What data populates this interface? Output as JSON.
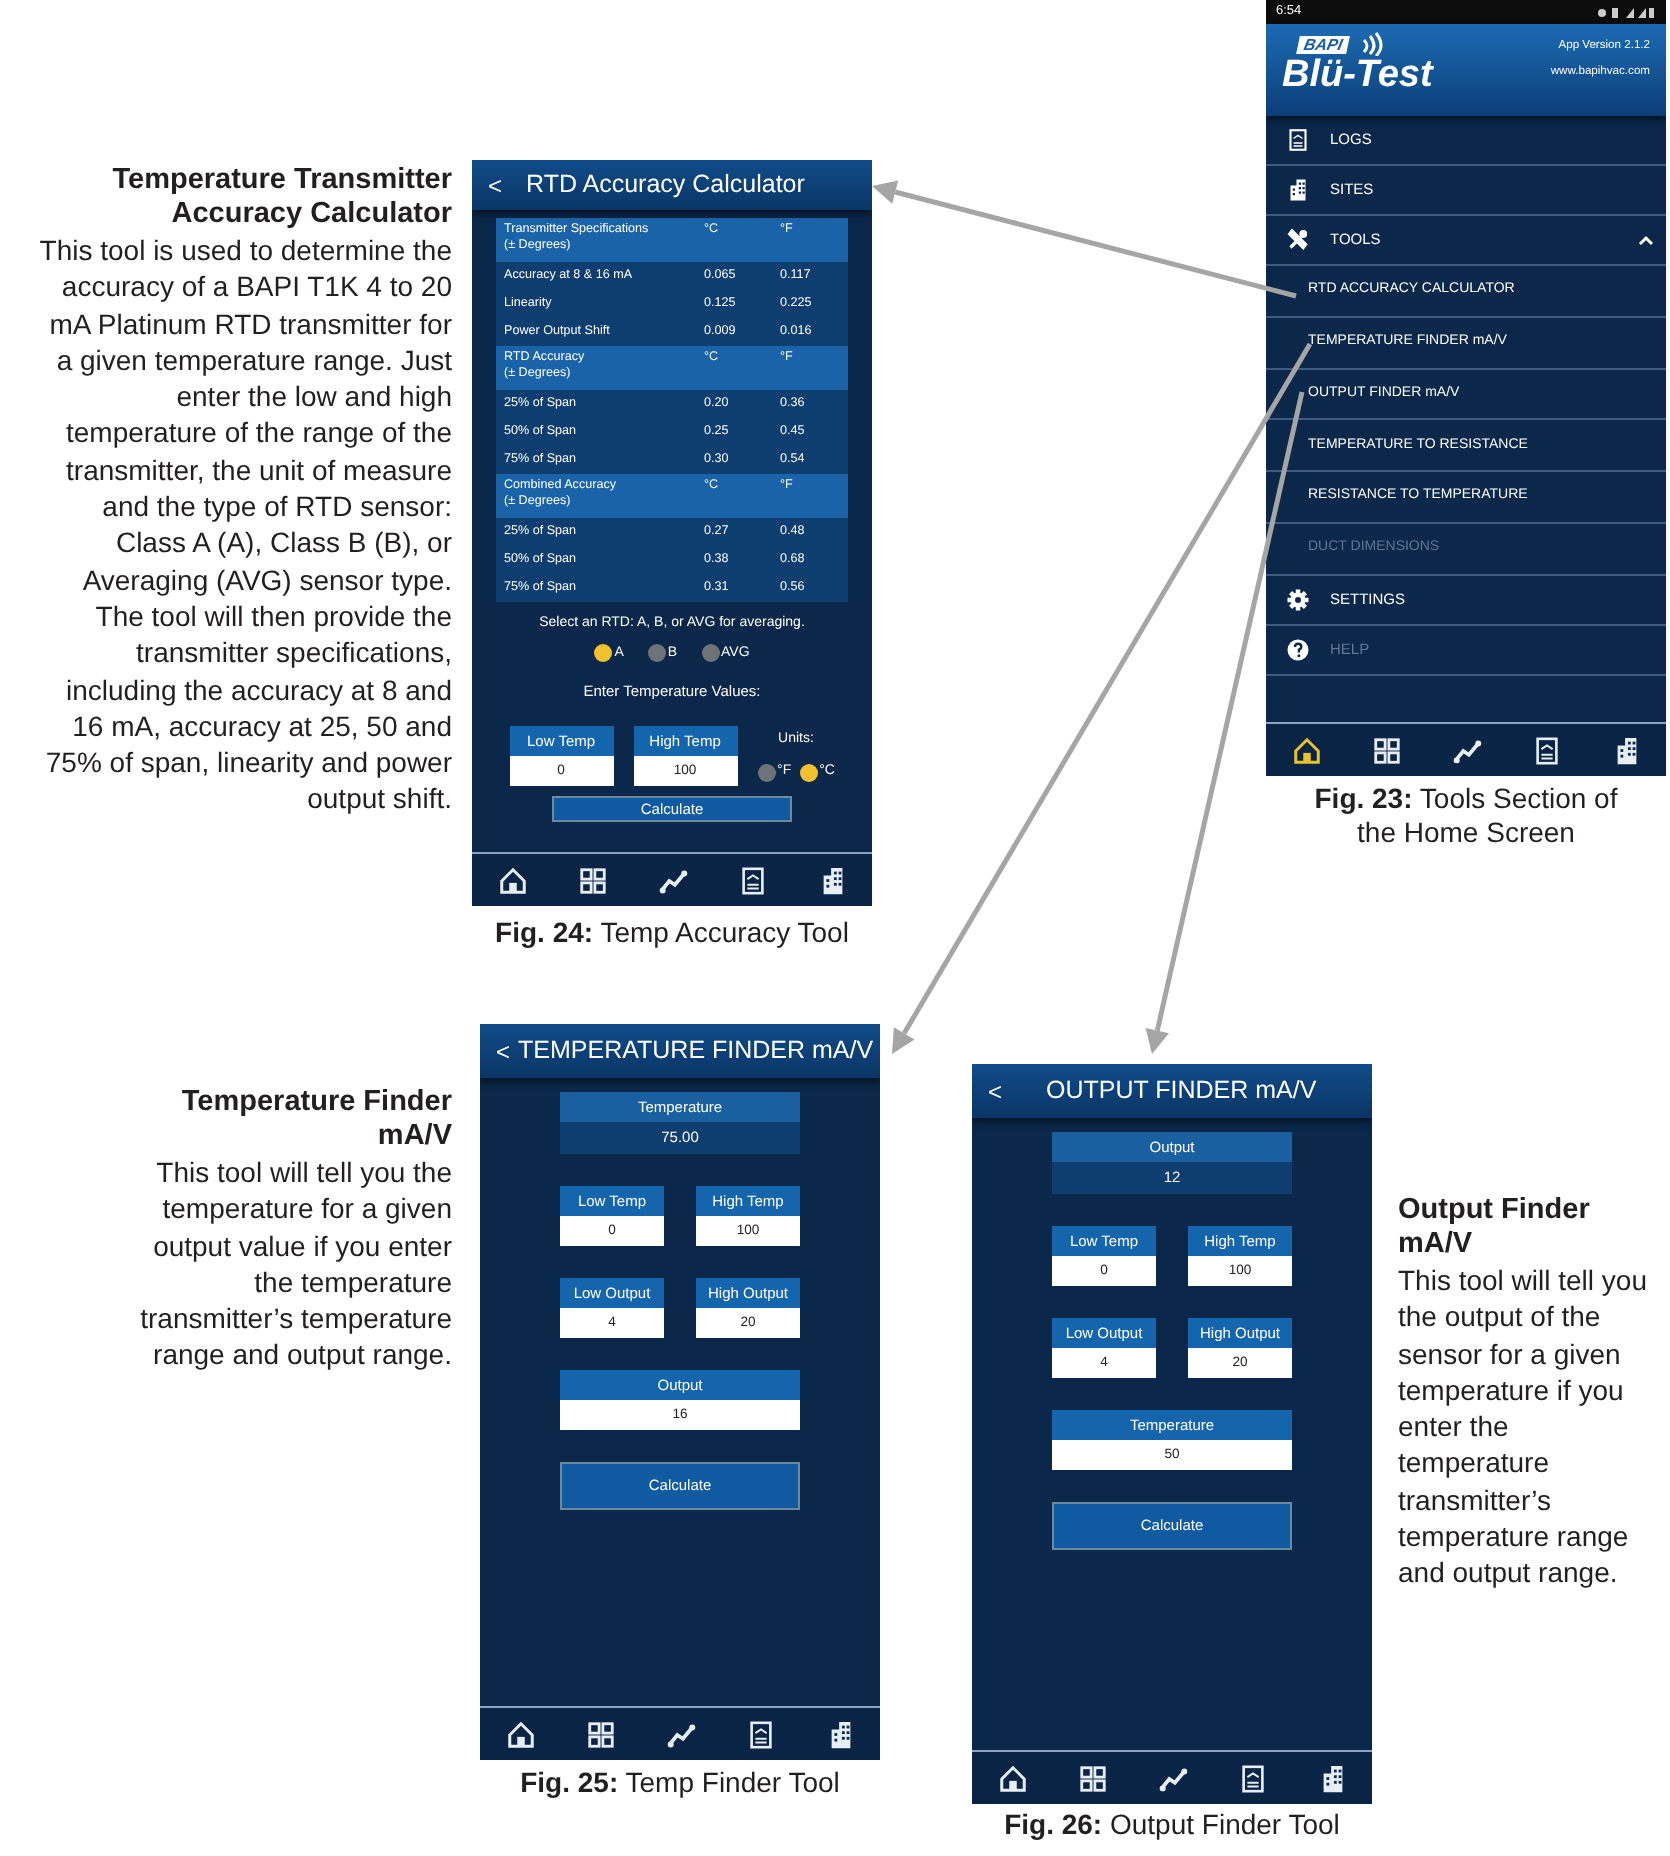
{
  "calculator_section": {
    "heading": "Temperature Transmitter Accuracy Calculator",
    "description": "This tool is used to determine the accuracy of a BAPI T1K 4 to 20 mA Platinum RTD transmitter for a given temperature range. Just enter the low and high temperature of the range of the transmitter, the unit of measure and the type of RTD sensor: Class A (A), Class B (B), or Averaging (AVG) sensor type. The tool will then provide the transmitter specifications, including the accuracy at 8 and 16 mA, accuracy at 25, 50 and 75% of span, linearity and power output shift.",
    "screen": {
      "back": "<",
      "title": "RTD Accuracy Calculator",
      "groups": [
        {
          "label": "Transmitter Specifications",
          "sublabel": "(± Degrees)",
          "col_c": "°C",
          "col_f": "°F",
          "rows": [
            [
              "Accuracy at 8 & 16 mA",
              "0.065",
              "0.117"
            ],
            [
              "Linearity",
              "0.125",
              "0.225"
            ],
            [
              "Power Output Shift",
              "0.009",
              "0.016"
            ]
          ]
        },
        {
          "label": "RTD Accuracy",
          "sublabel": "(± Degrees)",
          "col_c": "°C",
          "col_f": "°F",
          "rows": [
            [
              "25% of Span",
              "0.20",
              "0.36"
            ],
            [
              "50% of Span",
              "0.25",
              "0.45"
            ],
            [
              "75% of Span",
              "0.30",
              "0.54"
            ]
          ]
        },
        {
          "label": "Combined Accuracy",
          "sublabel": "(± Degrees)",
          "col_c": "°C",
          "col_f": "°F",
          "rows": [
            [
              "25% of Span",
              "0.27",
              "0.48"
            ],
            [
              "50% of Span",
              "0.38",
              "0.68"
            ],
            [
              "75% of Span",
              "0.31",
              "0.56"
            ]
          ]
        }
      ],
      "rtd_prompt": "Select an RTD: A, B, or AVG for averaging.",
      "rtd_options": [
        {
          "label": "A",
          "selected": true
        },
        {
          "label": "B",
          "selected": false
        },
        {
          "label": "AVG",
          "selected": false
        }
      ],
      "values_prompt": "Enter Temperature Values:",
      "fields": [
        {
          "label": "Low Temp",
          "value": "0"
        },
        {
          "label": "High Temp",
          "value": "100"
        }
      ],
      "units_label": "Units:",
      "unit_options": [
        {
          "label": "°F",
          "selected": false
        },
        {
          "label": "°C",
          "selected": true
        }
      ],
      "button": "Calculate",
      "nav": [
        {
          "kind": "home",
          "selected": false
        },
        {
          "kind": "dashboard",
          "selected": false
        },
        {
          "kind": "graph",
          "selected": false
        },
        {
          "kind": "logs",
          "selected": false
        },
        {
          "kind": "sites",
          "selected": false
        }
      ]
    },
    "caption": "**Fig. 24:** Temp Accuracy Tool"
  },
  "home_screen": {
    "time": "6:54",
    "logo_mark": "BAPI",
    "logo_text": "Blü-Test",
    "app_version": "App Version 2.1.2",
    "website": "www.bapihvac.com",
    "menu": [
      {
        "kind": "logs",
        "label": "LOGS",
        "disabled": false
      },
      {
        "kind": "sites",
        "label": "SITES",
        "disabled": false
      },
      {
        "kind": "tools",
        "label": "TOOLS",
        "disabled": false,
        "expanded": true,
        "children": [
          {
            "label": "RTD ACCURACY CALCULATOR",
            "disabled": false
          },
          {
            "label": "TEMPERATURE FINDER mA/V",
            "disabled": false
          },
          {
            "label": "OUTPUT FINDER mA/V",
            "disabled": false
          },
          {
            "label": "TEMPERATURE TO RESISTANCE",
            "disabled": false
          },
          {
            "label": "RESISTANCE TO TEMPERATURE",
            "disabled": false
          },
          {
            "label": "DUCT DIMENSIONS",
            "disabled": true
          }
        ]
      },
      {
        "kind": "settings",
        "label": "SETTINGS",
        "disabled": false
      },
      {
        "kind": "help",
        "label": "HELP",
        "disabled": true
      }
    ],
    "nav": [
      {
        "kind": "home",
        "selected": true
      },
      {
        "kind": "dashboard",
        "selected": false
      },
      {
        "kind": "graph",
        "selected": false
      },
      {
        "kind": "logs",
        "selected": false
      },
      {
        "kind": "sites",
        "selected": false
      }
    ],
    "caption": "**Fig. 23:** Tools Section of the Home Screen"
  },
  "temperature_finder_section": {
    "heading": "Temperature Finder mA/V",
    "description": "This tool will tell you the temperature for a given output value if you enter the temperature transmitter’s temperature range and output range.",
    "screen": {
      "back": "<",
      "title": "TEMPERATURE FINDER mA/V",
      "result": {
        "label": "Temperature",
        "value": "75.00"
      },
      "field_rows": [
        [
          {
            "label": "Low Temp",
            "value": "0"
          },
          {
            "label": "High Temp",
            "value": "100"
          }
        ],
        [
          {
            "label": "Low Output",
            "value": "4"
          },
          {
            "label": "High Output",
            "value": "20"
          }
        ],
        [
          {
            "label": "Output",
            "value": "16"
          }
        ]
      ],
      "button": "Calculate",
      "nav": [
        {
          "kind": "home",
          "selected": false
        },
        {
          "kind": "dashboard",
          "selected": false
        },
        {
          "kind": "graph",
          "selected": false
        },
        {
          "kind": "logs",
          "selected": false
        },
        {
          "kind": "sites",
          "selected": false
        }
      ]
    },
    "caption": "**Fig. 25:** Temp Finder Tool"
  },
  "output_finder_section": {
    "heading": "Output Finder mA/V",
    "description": "This tool will tell you the output of the sensor for a given temperature if you enter the temperature transmitter’s temperature range and output range.",
    "screen": {
      "back": "<",
      "title": "OUTPUT FINDER mA/V",
      "result": {
        "label": "Output",
        "value": "12"
      },
      "field_rows": [
        [
          {
            "label": "Low Temp",
            "value": "0"
          },
          {
            "label": "High Temp",
            "value": "100"
          }
        ],
        [
          {
            "label": "Low Output",
            "value": "4"
          },
          {
            "label": "High Output",
            "value": "20"
          }
        ],
        [
          {
            "label": "Temperature",
            "value": "50"
          }
        ]
      ],
      "button": "Calculate",
      "nav": [
        {
          "kind": "home",
          "selected": false
        },
        {
          "kind": "dashboard",
          "selected": false
        },
        {
          "kind": "graph",
          "selected": false
        },
        {
          "kind": "logs",
          "selected": false
        },
        {
          "kind": "sites",
          "selected": false
        }
      ]
    },
    "caption": "**Fig. 26:** Output Finder Tool"
  }
}
